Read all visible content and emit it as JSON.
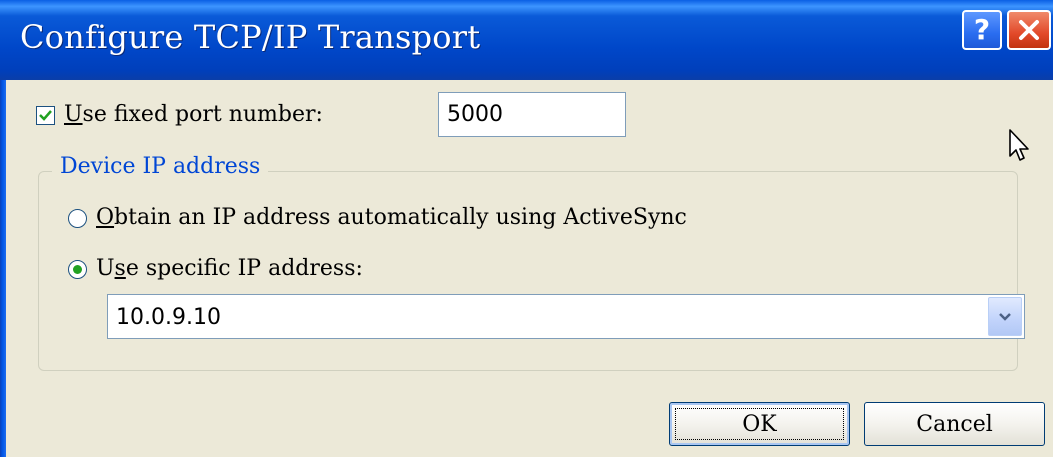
{
  "window": {
    "title": "Configure TCP/IP Transport",
    "help_button_label": "?",
    "close_button_label": "X"
  },
  "port": {
    "checkbox_checked": true,
    "label_accel": "U",
    "label_rest": "se fixed port number:",
    "value": "5000"
  },
  "device_ip": {
    "group_label": "Device IP address",
    "option_auto": {
      "accel": "O",
      "label_rest": "btain an IP address automatically using ActiveSync",
      "selected": false
    },
    "option_specific": {
      "label_pre": "U",
      "accel": "s",
      "label_rest": "e specific IP address:",
      "selected": true
    },
    "ip_value": "10.0.9.10"
  },
  "buttons": {
    "ok": "OK",
    "cancel": "Cancel"
  },
  "colors": {
    "titlebar": "#0047c9",
    "dialog_bg": "#ece9d8",
    "group_label": "#0046d5",
    "radio_dot": "#21a121"
  }
}
